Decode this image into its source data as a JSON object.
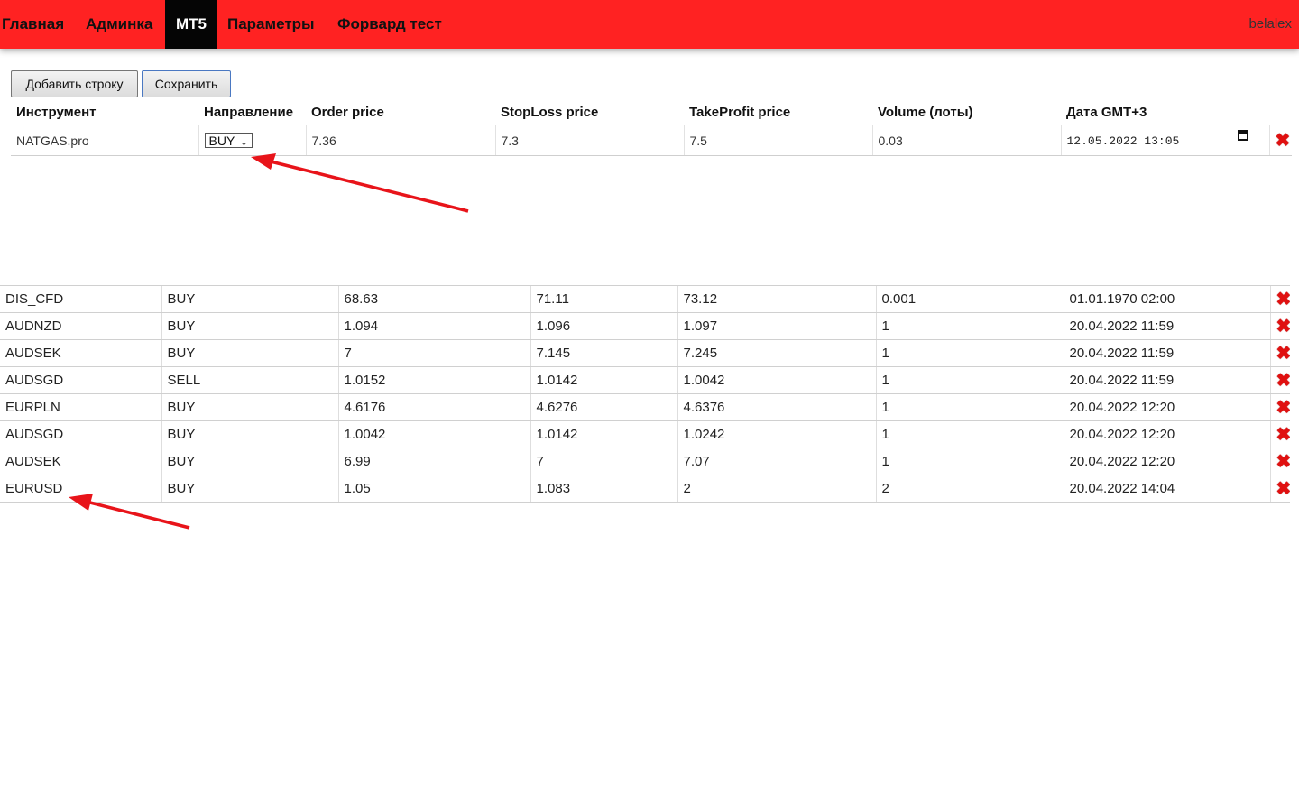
{
  "navbar": {
    "items": [
      {
        "label": "Главная"
      },
      {
        "label": "Админка"
      },
      {
        "label": "MT5"
      },
      {
        "label": "Параметры"
      },
      {
        "label": "Форвард тест"
      }
    ],
    "active_item": "MT5",
    "user": "belalex",
    "bg_color": "#ff2222"
  },
  "toolbar": {
    "add_row_label": "Добавить строку",
    "save_label": "Сохранить"
  },
  "edit_table": {
    "headers": [
      "Инструмент",
      "Направление",
      "Order price",
      "StopLoss price",
      "TakeProfit price",
      "Volume (лоты)",
      "Дата GMT+3"
    ],
    "row": {
      "instrument": "NATGAS.pro",
      "direction": "BUY",
      "order_price": "7.36",
      "stoploss_price": "7.3",
      "takeprofit_price": "7.5",
      "volume": "0.03",
      "date": "12.05.2022 13:05"
    }
  },
  "rows": [
    {
      "instrument": "DIS_CFD",
      "direction": "BUY",
      "order_price": "68.63",
      "stoploss_price": "71.11",
      "takeprofit_price": "73.12",
      "volume": "0.001",
      "date": "01.01.1970 02:00"
    },
    {
      "instrument": "AUDNZD",
      "direction": "BUY",
      "order_price": "1.094",
      "stoploss_price": "1.096",
      "takeprofit_price": "1.097",
      "volume": "1",
      "date": "20.04.2022 11:59"
    },
    {
      "instrument": "AUDSEK",
      "direction": "BUY",
      "order_price": "7",
      "stoploss_price": "7.145",
      "takeprofit_price": "7.245",
      "volume": "1",
      "date": "20.04.2022 11:59"
    },
    {
      "instrument": "AUDSGD",
      "direction": "SELL",
      "order_price": "1.0152",
      "stoploss_price": "1.0142",
      "takeprofit_price": "1.0042",
      "volume": "1",
      "date": "20.04.2022 11:59"
    },
    {
      "instrument": "EURPLN",
      "direction": "BUY",
      "order_price": "4.6176",
      "stoploss_price": "4.6276",
      "takeprofit_price": "4.6376",
      "volume": "1",
      "date": "20.04.2022 12:20"
    },
    {
      "instrument": "AUDSGD",
      "direction": "BUY",
      "order_price": "1.0042",
      "stoploss_price": "1.0142",
      "takeprofit_price": "1.0242",
      "volume": "1",
      "date": "20.04.2022 12:20"
    },
    {
      "instrument": "AUDSEK",
      "direction": "BUY",
      "order_price": "6.99",
      "stoploss_price": "7",
      "takeprofit_price": "7.07",
      "volume": "1",
      "date": "20.04.2022 12:20"
    },
    {
      "instrument": "EURUSD",
      "direction": "BUY",
      "order_price": "1.05",
      "stoploss_price": "1.083",
      "takeprofit_price": "2",
      "volume": "2",
      "date": "20.04.2022 14:04"
    }
  ],
  "icons": {
    "delete": "delete-x-icon",
    "calendar": "calendar-icon",
    "select_chevron": "chevron-down-icon"
  },
  "annotation_color": "#e8141a"
}
